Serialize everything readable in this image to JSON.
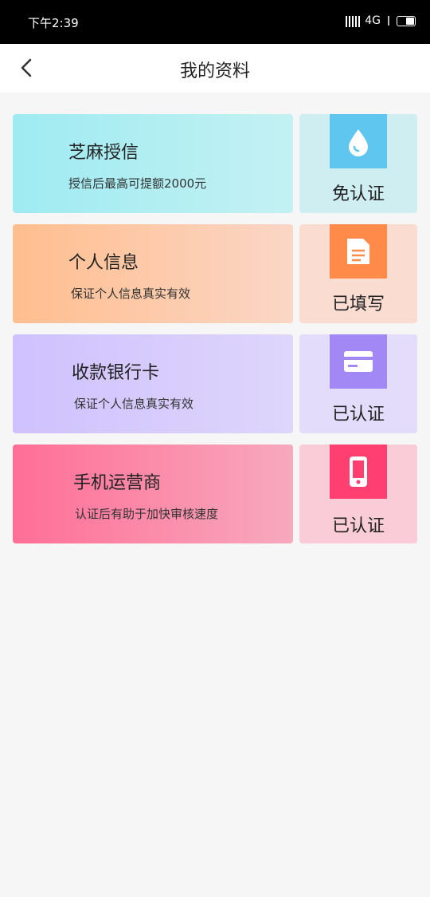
{
  "status_bar": {
    "time": "下午2:39",
    "network": "4G"
  },
  "header": {
    "title": "我的资料"
  },
  "cards": [
    {
      "title": "芝麻授信",
      "subtitle": "授信后最高可提额2000元",
      "status": "免认证",
      "icon": "drop-icon",
      "colors": {
        "icon_bg": "#5fc6f0",
        "card_start": "#9eebf2",
        "card_end": "#c4f1f3"
      }
    },
    {
      "title": "个人信息",
      "subtitle": "保证个人信息真实有效",
      "status": "已填写",
      "icon": "document-icon",
      "colors": {
        "icon_bg": "#ff8a4a",
        "card_start": "#ffbe8e",
        "card_end": "#fbd6c6"
      }
    },
    {
      "title": "收款银行卡",
      "subtitle": "保证个人信息真实有效",
      "status": "已认证",
      "icon": "bank-card-icon",
      "colors": {
        "icon_bg": "#a288f5",
        "card_start": "#cfc1ff",
        "card_end": "#ded6fb"
      }
    },
    {
      "title": "手机运营商",
      "subtitle": "认证后有助于加快审核速度",
      "status": "已认证",
      "icon": "mobile-phone-icon",
      "colors": {
        "icon_bg": "#ff3f6f",
        "card_start": "#ff6e96",
        "card_end": "#f7a9bd"
      }
    }
  ]
}
